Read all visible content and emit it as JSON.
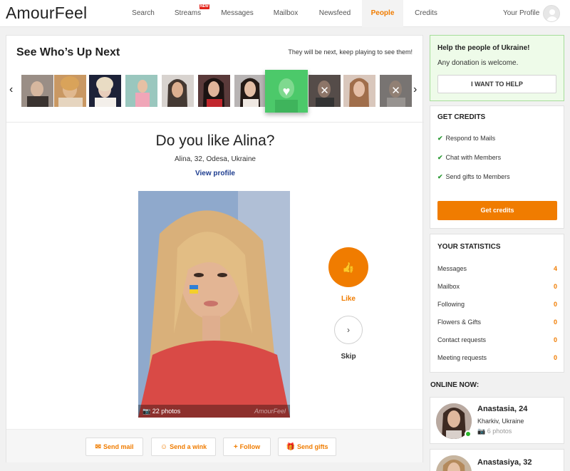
{
  "header": {
    "logo": "AmourFeel",
    "nav": [
      {
        "label": "Search",
        "icon": "",
        "active": false
      },
      {
        "label": "Streams",
        "icon": "",
        "active": false,
        "badge": "NEW"
      },
      {
        "label": "Messages",
        "icon": "",
        "active": false
      },
      {
        "label": "Mailbox",
        "icon": "",
        "active": false
      },
      {
        "label": "Newsfeed",
        "icon": "",
        "active": false
      },
      {
        "label": "People",
        "icon": "",
        "active": true
      },
      {
        "label": "Credits",
        "icon": "",
        "active": false
      }
    ],
    "profile_label": "Your Profile",
    "accent_color": "#f07c00"
  },
  "upnext": {
    "title": "See Who’s Up Next",
    "subtitle": "They will be next, keep playing to see them!",
    "left_arrow": "‹",
    "right_arrow": "›",
    "liked_icon": "♥",
    "skipped_icon": "✕"
  },
  "profile": {
    "question": "Do you like Alina?",
    "details": "Alina, 32, Odesa, Ukraine",
    "view_profile": "View profile",
    "photo_count": "22 photos",
    "watermark": "AmourFeel"
  },
  "vote": {
    "like_icon": "👍",
    "like_label": "Like",
    "skip_icon": "›",
    "skip_label": "Skip"
  },
  "actions": [
    {
      "label": "Send mail",
      "icon": "✉"
    },
    {
      "label": "Send a wink",
      "icon": "☺"
    },
    {
      "label": "Follow",
      "icon": "+"
    },
    {
      "label": "Send gifts",
      "icon": "🎁"
    }
  ],
  "ukraine": {
    "title": "Help the people of Ukraine!",
    "text": "Any donation is welcome.",
    "button": "I WANT TO HELP"
  },
  "credits": {
    "title": "GET CREDITS",
    "check_icon": "✔",
    "items": [
      "Respond to Mails",
      "Chat with Members",
      "Send gifts to Members"
    ],
    "button": "Get credits"
  },
  "stats": {
    "title": "YOUR STATISTICS",
    "rows": [
      {
        "label": "Messages",
        "value": "4"
      },
      {
        "label": "Mailbox",
        "value": "0"
      },
      {
        "label": "Following",
        "value": "0"
      },
      {
        "label": "Flowers & Gifts",
        "value": "0"
      },
      {
        "label": "Contact requests",
        "value": "0"
      },
      {
        "label": "Meeting requests",
        "value": "0"
      }
    ]
  },
  "online": {
    "title": "ONLINE NOW:",
    "users": [
      {
        "name": "Anastasia, 24",
        "location": "Kharkiv, Ukraine",
        "photos": "6 photos",
        "camera_icon": "📷"
      },
      {
        "name": "Anastasiya, 32",
        "location": "",
        "photos": "",
        "camera_icon": ""
      }
    ]
  }
}
